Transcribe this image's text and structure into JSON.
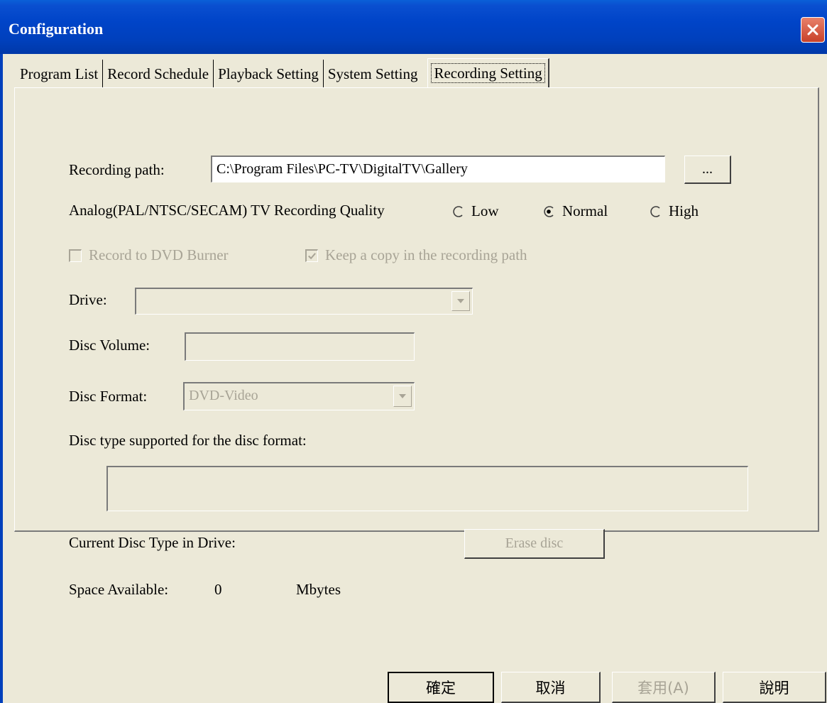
{
  "window": {
    "title": "Configuration"
  },
  "tabs": [
    {
      "label": "Program List"
    },
    {
      "label": "Record Schedule"
    },
    {
      "label": "Playback Setting"
    },
    {
      "label": "System Setting"
    },
    {
      "label": "Recording Setting",
      "active": true
    }
  ],
  "recording_path": {
    "label": "Recording path:",
    "value": "C:\\Program Files\\PC-TV\\DigitalTV\\Gallery",
    "browse_label": "..."
  },
  "quality": {
    "label": "Analog(PAL/NTSC/SECAM) TV Recording Quality",
    "options": [
      {
        "label": "Low",
        "selected": false
      },
      {
        "label": "Normal",
        "selected": true
      },
      {
        "label": "High",
        "selected": false
      }
    ]
  },
  "dvd": {
    "record_to_burner_label": "Record to DVD Burner",
    "record_to_burner_checked": false,
    "keep_copy_label": "Keep a copy in the recording path",
    "keep_copy_checked": true
  },
  "drive": {
    "label": "Drive:",
    "value": ""
  },
  "disc_volume": {
    "label": "Disc Volume:",
    "value": ""
  },
  "disc_format": {
    "label": "Disc Format:",
    "value": "DVD-Video"
  },
  "disc_type_supported": {
    "label": "Disc type supported for the disc format:",
    "value": ""
  },
  "current_disc": {
    "label": "Current Disc Type in Drive:",
    "erase_label": "Erase disc"
  },
  "space": {
    "label": "Space Available:",
    "value": "0",
    "unit": "Mbytes"
  },
  "buttons": {
    "ok": "確定",
    "cancel": "取消",
    "apply": "套用(A)",
    "help": "說明"
  },
  "colors": {
    "titlebar": "#0044c8",
    "face": "#ece9d8",
    "disabled_text": "#a8a496"
  }
}
